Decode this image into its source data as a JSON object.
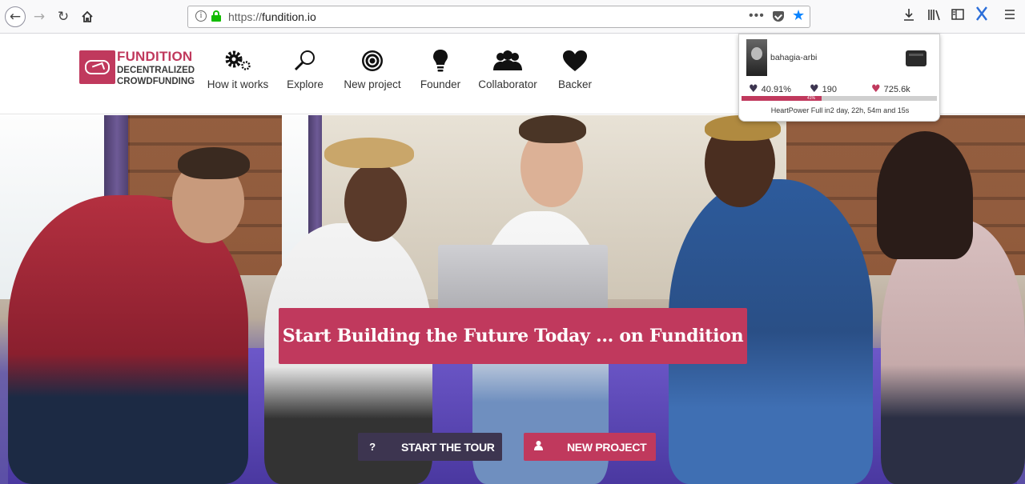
{
  "browser": {
    "url_protocol": "https://",
    "url_host": "fundition.io",
    "colors": {
      "secure": "#12bc00",
      "star": "#0a84ff"
    }
  },
  "brand": {
    "name": "FUNDITION",
    "tagline_line1": "DECENTRALIZED",
    "tagline_line2": "CROWDFUNDING",
    "color": "#c0395d"
  },
  "menu": [
    {
      "label": "How it works",
      "icon": "gears-icon"
    },
    {
      "label": "Explore",
      "icon": "search-icon"
    },
    {
      "label": "New project",
      "icon": "target-icon"
    },
    {
      "label": "Founder",
      "icon": "lightbulb-icon"
    },
    {
      "label": "Collaborator",
      "icon": "people-icon"
    },
    {
      "label": "Backer",
      "icon": "heart-icon"
    }
  ],
  "hero": {
    "headline": "Start Building the Future Today ... on Fundition",
    "tour_button": "START THE TOUR",
    "tour_icon": "?",
    "new_project_button": "NEW PROJECT"
  },
  "popup": {
    "username": "bahagia-arbi",
    "voting_power": "40.91%",
    "stat_2": "190",
    "stat_3": "725.6k",
    "bar_label": "41%",
    "bar_fill": 0.41,
    "note": "HeartPower Full in2 day, 22h, 54m and 15s"
  }
}
